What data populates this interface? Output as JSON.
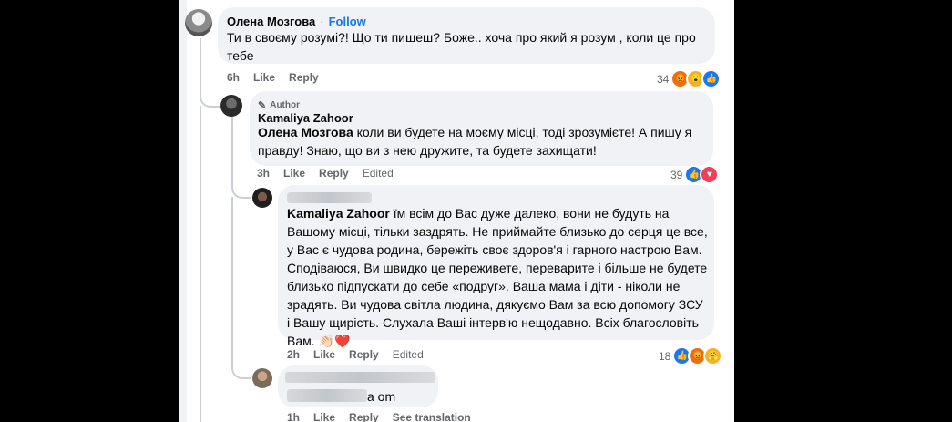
{
  "comments": [
    {
      "author": "Олена Мозгова",
      "follow_label": "Follow",
      "separator": "·",
      "text": "Ти в своєму розумі?! Що ти пишеш? Боже.. хоча про який я розум , коли це про тебе",
      "time": "6h",
      "like_label": "Like",
      "reply_label": "Reply",
      "reaction_count": "34",
      "reactions": [
        "angry",
        "wow",
        "like"
      ]
    },
    {
      "badge": "Author",
      "author": "Kamaliya Zahoor",
      "mention": "Олена Мозгова",
      "text": " коли ви будете на моєму місці, тоді зрозумієте! А пишу я правду! Знаю, що ви з нею дружите, та будете захищати!",
      "time": "3h",
      "like_label": "Like",
      "reply_label": "Reply",
      "edited_label": "Edited",
      "reaction_count": "39",
      "reactions": [
        "like",
        "love"
      ]
    },
    {
      "author_hidden": true,
      "mention": "Kamaliya Zahoor",
      "text": " їм всім до Вас дуже далеко, вони не будуть на Вашому місці, тільки заздрять. Не приймайте близько до серця це все, у Вас є чудова родина, бережіть своє здоров'я і гарного настрою Вам. Сподіваюся, Ви швидко це переживете, переварите і більше не будете близько підпускати до себе «подруг». Ваша мама і діти - ніколи не зрадять. Ви чудова світла людина, дякуємо Вам за всю допомогу ЗСУ і Вашу щирість. Слухала Ваші інтерв'ю нещодавно. Всіх благословіть Вам.",
      "emoji": "👏🏻❤️",
      "time": "2h",
      "like_label": "Like",
      "reply_label": "Reply",
      "edited_label": "Edited",
      "reaction_count": "18",
      "reactions": [
        "like",
        "angry",
        "care"
      ]
    },
    {
      "author_hidden": true,
      "visible_text": "a om",
      "time": "1h",
      "like_label": "Like",
      "reply_label": "Reply",
      "translation_label": "See translation"
    }
  ],
  "colors": {
    "link": "#1877f2",
    "bubble": "#f0f2f5",
    "meta": "#65676b",
    "like": "#1877f2",
    "love": "#f33e58",
    "angry": "#e9710f"
  }
}
